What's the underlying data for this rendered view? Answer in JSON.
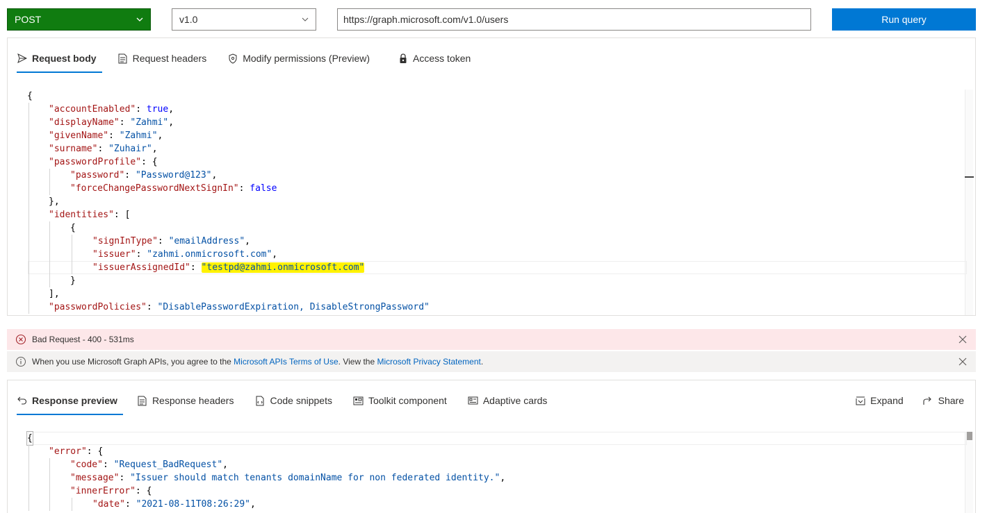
{
  "query": {
    "method": "POST",
    "version": "v1.0",
    "url": "https://graph.microsoft.com/v1.0/users",
    "run_label": "Run query"
  },
  "request_tabs": [
    {
      "label": "Request body",
      "icon": "send-icon",
      "active": true
    },
    {
      "label": "Request headers",
      "icon": "document-icon",
      "active": false
    },
    {
      "label": "Modify permissions (Preview)",
      "icon": "shield-icon",
      "active": false
    },
    {
      "label": "Access token",
      "icon": "lock-icon",
      "active": false
    }
  ],
  "request_body": {
    "open_brace": "{",
    "accountEnabled": {
      "key": "\"accountEnabled\"",
      "value": "true"
    },
    "displayName": {
      "key": "\"displayName\"",
      "value": "\"Zahmi\""
    },
    "givenName": {
      "key": "\"givenName\"",
      "value": "\"Zahmi\""
    },
    "surname": {
      "key": "\"surname\"",
      "value": "\"Zuhair\""
    },
    "passwordProfile": {
      "key": "\"passwordProfile\"",
      "open": "{"
    },
    "password": {
      "key": "\"password\"",
      "value": "\"Password@123\""
    },
    "forceChange": {
      "key": "\"forceChangePasswordNextSignIn\"",
      "value": "false"
    },
    "close_profile": "},",
    "identities": {
      "key": "\"identities\"",
      "open": "["
    },
    "identity_open": "{",
    "signInType": {
      "key": "\"signInType\"",
      "value": "\"emailAddress\""
    },
    "issuer": {
      "key": "\"issuer\"",
      "value": "\"zahmi.onmicrosoft.com\""
    },
    "issuerAssignedId": {
      "key": "\"issuerAssignedId\"",
      "value": "\"testpd@zahmi.onmicrosoft.com\""
    },
    "identity_close": "}",
    "close_identities": "],",
    "passwordPolicies": {
      "key": "\"passwordPolicies\"",
      "value": "\"DisablePasswordExpiration, DisableStrongPassword\""
    }
  },
  "status": {
    "error_text": "Bad Request - 400 - 531ms",
    "info_prefix": "When you use Microsoft Graph APIs, you agree to the ",
    "terms_link": "Microsoft APIs Terms of Use",
    "info_middle": ". View the ",
    "privacy_link": "Microsoft Privacy Statement",
    "info_suffix": "."
  },
  "response_tabs": [
    {
      "label": "Response preview",
      "icon": "undo-icon",
      "active": true
    },
    {
      "label": "Response headers",
      "icon": "document-icon",
      "active": false
    },
    {
      "label": "Code snippets",
      "icon": "code-icon",
      "active": false
    },
    {
      "label": "Toolkit component",
      "icon": "toolkit-icon",
      "active": false
    },
    {
      "label": "Adaptive cards",
      "icon": "card-icon",
      "active": false
    }
  ],
  "response_actions": [
    {
      "label": "Expand",
      "icon": "expand-icon"
    },
    {
      "label": "Share",
      "icon": "share-icon"
    }
  ],
  "response_body": {
    "open_brace": "{",
    "error": {
      "key": "\"error\"",
      "open": "{"
    },
    "code": {
      "key": "\"code\"",
      "value": "\"Request_BadRequest\""
    },
    "message": {
      "key": "\"message\"",
      "value": "\"Issuer should match tenants domainName for non federated identity.\""
    },
    "innerError": {
      "key": "\"innerError\"",
      "open": "{"
    },
    "date": {
      "key": "\"date\"",
      "value": "\"2021-08-11T08:26:29\""
    }
  }
}
